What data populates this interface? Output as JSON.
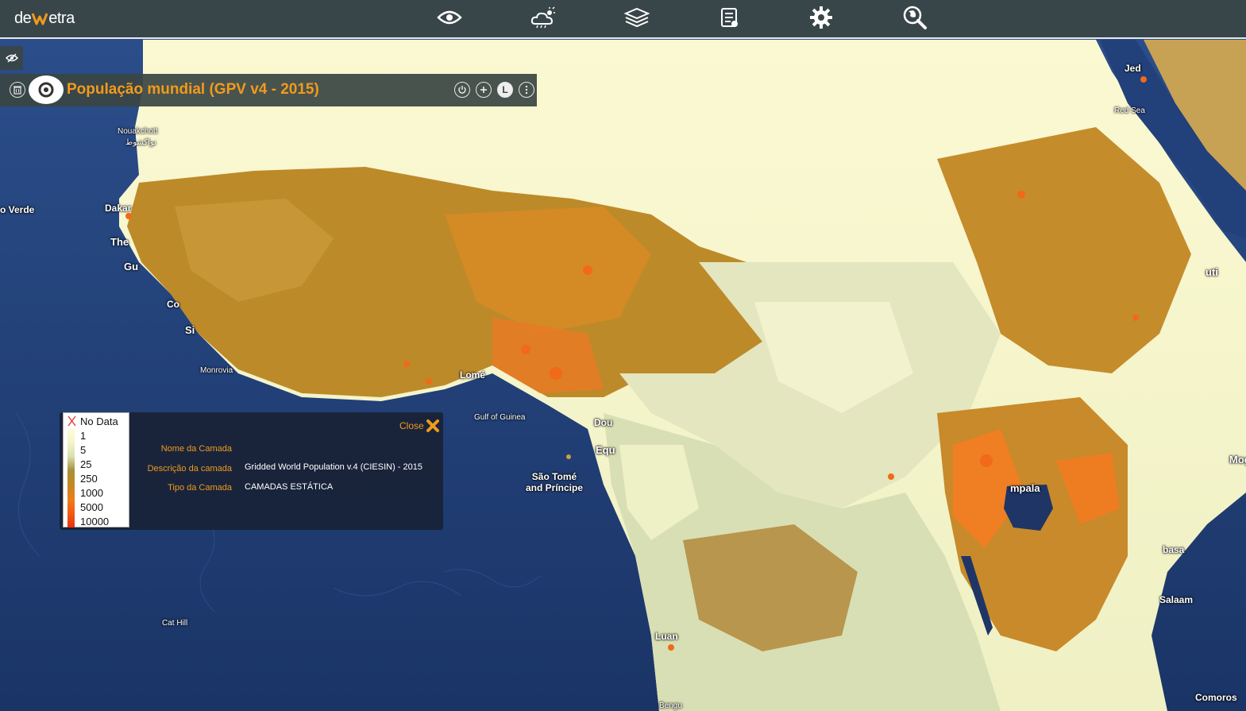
{
  "app": {
    "logo_left": "de",
    "logo_right": "etra"
  },
  "toolbar": {
    "icons": [
      "eye-icon",
      "weather-cloud-icon",
      "layers-icon",
      "scroll-icon",
      "gear-icon",
      "globe-search-icon"
    ]
  },
  "layer": {
    "title": "População mundial (GPV v4 - 2015)",
    "info_button": "L"
  },
  "legend": {
    "items": [
      "No Data",
      "1",
      "5",
      "25",
      "250",
      "1000",
      "5000",
      "10000"
    ],
    "colors": [
      "#fdfdd8",
      "#d8e0b0",
      "#a88e3a",
      "#c08a22",
      "#f07c1c",
      "#f05a14",
      "#ee2e10"
    ]
  },
  "info": {
    "close_label": "Close",
    "rows": [
      {
        "key": "Nome da Camada",
        "value": ""
      },
      {
        "key": "Descrição da camada",
        "value": "Gridded World Population v.4 (CIESIN) - 2015"
      },
      {
        "key": "Tipo da Camada",
        "value": "CAMADAS ESTÁTICA"
      }
    ]
  },
  "map_labels": {
    "cabo_verde": "o Verde",
    "nouakchott": "Nouakchott",
    "nouakchott_ar": "نواكشوط",
    "dakar": "Dakar",
    "the_gambia": "The",
    "guinea": "Gu",
    "conakry": "Co",
    "sierra": "Si",
    "monrovia": "Monrovia",
    "lome": "Lomé",
    "gulf_of_guinea": "Gulf of Guinea",
    "douala": "Dou",
    "equatorial": "Equ",
    "sao_tome_1": "São Tomé",
    "sao_tome_2": "and Príncipe",
    "cat_hill": "Cat Hill",
    "luanda": "Luan",
    "benguela": "Bengu",
    "jeddah": "Jed",
    "red_sea": "Red Sea",
    "djibouti": "uti",
    "kampala": "mpala",
    "mombasa": "basa",
    "dar_es_salaam": "Salaam",
    "comoros": "Comoros",
    "mogadishu": "Mog"
  }
}
